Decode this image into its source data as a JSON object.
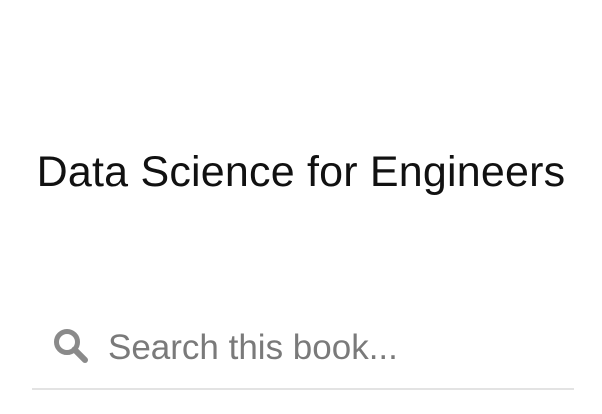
{
  "book": {
    "title": "Data Science for Engineers"
  },
  "search": {
    "placeholder": "Search this book...",
    "value": "",
    "icon": "search-icon"
  },
  "colors": {
    "background": "#ffffff",
    "title_text": "#111111",
    "placeholder_text": "#7a7a7a",
    "icon": "#8a8a8a",
    "divider": "#e3e3e3"
  }
}
